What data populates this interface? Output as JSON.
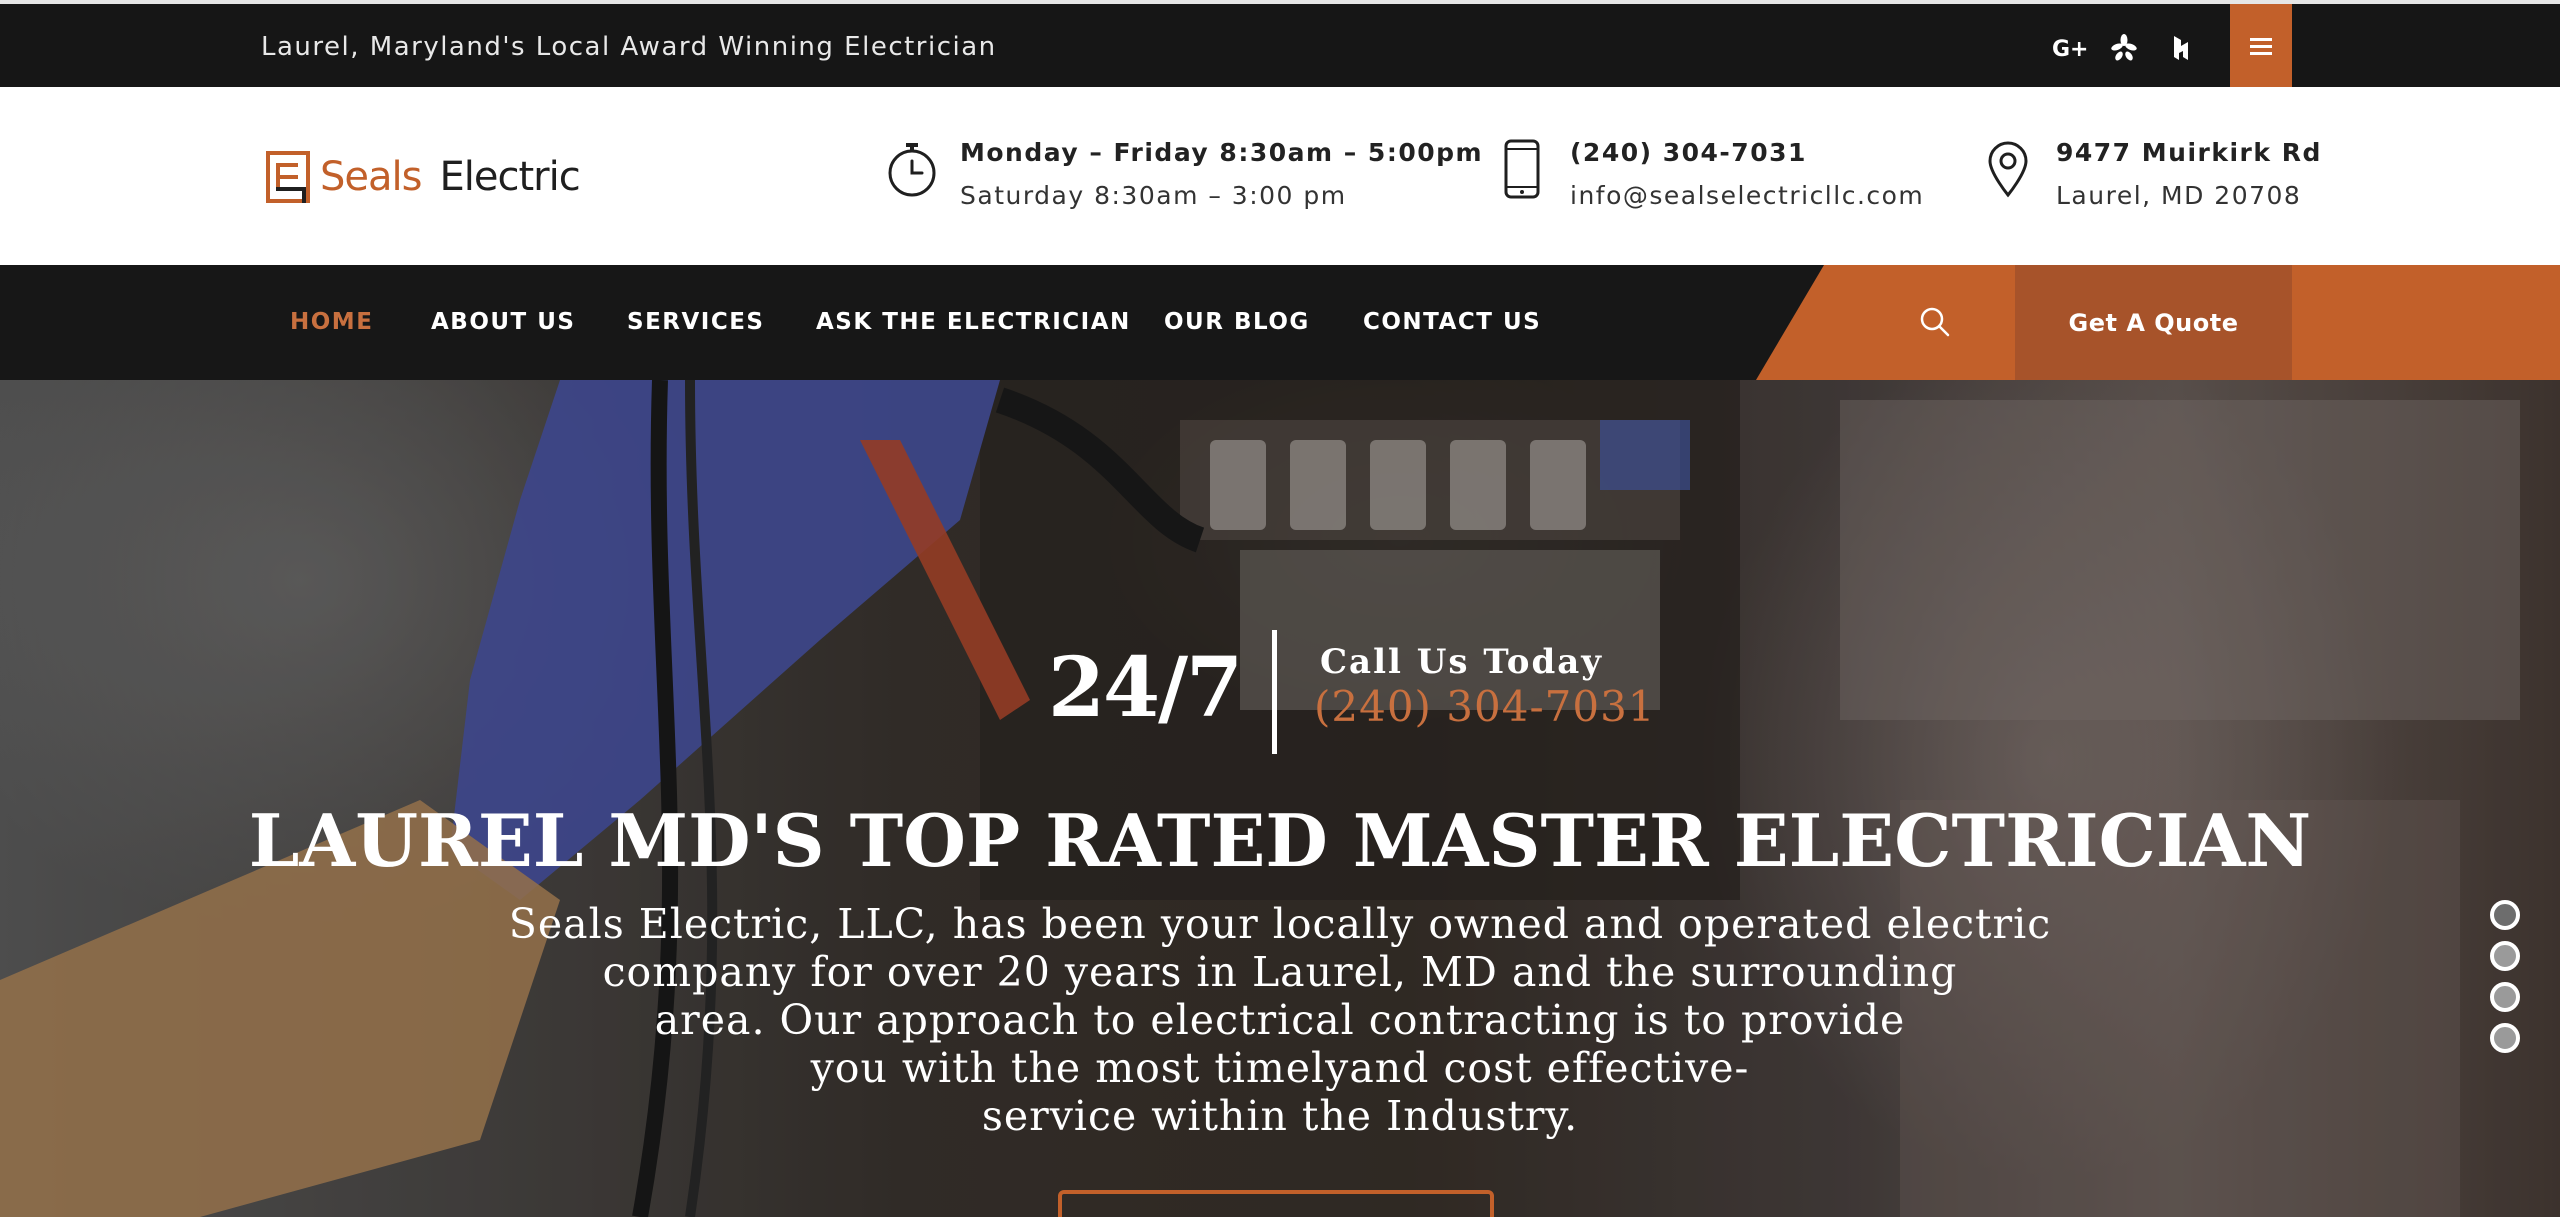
{
  "topbar": {
    "tagline": "Laurel, Maryland's Local Award Winning Electrician",
    "social": [
      {
        "icon": "google-plus-icon",
        "glyph": "G+"
      },
      {
        "icon": "yelp-icon",
        "glyph": "✱"
      },
      {
        "icon": "houzz-icon",
        "glyph": "▚"
      }
    ],
    "menu_icon": "hamburger-menu-icon"
  },
  "header": {
    "logo": {
      "word1": "Seals",
      "word2": "Electric"
    },
    "hours": {
      "line1": "Monday – Friday 8:30am – 5:00pm",
      "line2": "Saturday 8:30am – 3:00 pm"
    },
    "contact": {
      "line1": "(240) 304-7031",
      "line2": "info@sealselectricllc.com"
    },
    "address": {
      "line1": "9477 Muirkirk Rd",
      "line2": "Laurel, MD 20708"
    }
  },
  "nav": {
    "items": [
      {
        "label": "HOME",
        "active": true
      },
      {
        "label": "ABOUT US",
        "active": false
      },
      {
        "label": "SERVICES",
        "active": false
      },
      {
        "label": "ASK THE ELECTRICIAN",
        "active": false
      },
      {
        "label": "OUR BLOG",
        "active": false
      },
      {
        "label": "CONTACT US",
        "active": false
      }
    ],
    "quote_label": "Get A Quote"
  },
  "hero": {
    "badge": "24/7",
    "call_label": "Call Us Today",
    "call_phone": "(240) 304-7031",
    "title": "LAUREL MD'S TOP RATED MASTER ELECTRICIAN",
    "text_lines": [
      "Seals Electric, LLC, has been your locally owned and operated electric",
      "company for over 20 years in Laurel, MD and the surrounding",
      "area. Our approach to electrical contracting is to provide",
      "you with the most timelyand cost effective-",
      "service within the Industry."
    ],
    "slides": 4,
    "active_slide": 1
  },
  "colors": {
    "accent": "#c2602a",
    "accent_dark": "#a7532a",
    "accent_text": "#c8703f",
    "dark_bar": "#161616"
  }
}
